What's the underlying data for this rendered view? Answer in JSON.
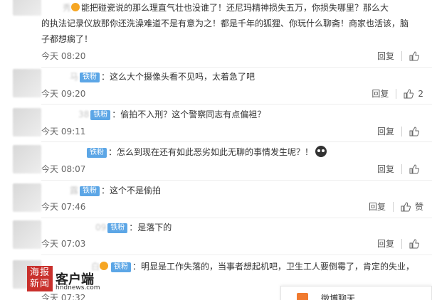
{
  "comments": [
    {
      "user": "秀",
      "badge": "",
      "lines": [
        "能把碰瓷说的那么理直气壮也没谁了！还尼玛精神损失五万，你损失哪里？那么大",
        "的执法记录仪放那你还洗澡难道不是有意为之！都是千年的狐狸、你玩什么聊斋！商家也活该，脑",
        "子都想瘸了！"
      ],
      "time": "今天 08:20",
      "reply": "回复",
      "likes": ""
    },
    {
      "user": "马",
      "badge": "铁粉",
      "lines": [
        "：这么大个摄像头看不见吗，太着急了吧"
      ],
      "time": "今天 09:20",
      "reply": "回复",
      "likes": "2"
    },
    {
      "user": "38",
      "badge": "铁粉",
      "lines": [
        "：偷拍不入刑？这个警察同志有点偏袒？"
      ],
      "time": "今天 09:11",
      "reply": "回复",
      "likes": ""
    },
    {
      "user": "",
      "badge": "铁粉",
      "lines": [
        "：怎么到现在还有如此恶劣如此无聊的事情发生呢？！"
      ],
      "time": "今天 08:07",
      "reply": "回复",
      "likes": ""
    },
    {
      "user": "露",
      "badge": "铁粉",
      "lines": [
        "：这个不是偷拍"
      ],
      "time": "今天 07:46",
      "reply": "回复",
      "likes": "赞"
    },
    {
      "user": "09",
      "badge": "铁粉",
      "lines": [
        "：是落下的"
      ],
      "time": "今天 07:03",
      "reply": "回复",
      "likes": ""
    },
    {
      "user": "白",
      "badge": "铁粉",
      "lines": [
        "：明显是工作失落的，当事者想起机吧，卫生工人要倒霉了，肯定的失业，"
      ],
      "time": "今天 07:32",
      "reply": "",
      "likes": ""
    }
  ],
  "watermark": {
    "logo_line1": "海报",
    "logo_line2": "新闻",
    "brand": "客户端",
    "sub": "hndnews.com"
  },
  "popup": {
    "text": "微博聊天"
  },
  "icons": {
    "like": "thumbs-up-icon",
    "emoji": "emoji-icon",
    "vip": "vip-icon",
    "message": "message-icon"
  },
  "colors": {
    "badge": "#5ca6e6",
    "logo": "#c9302c",
    "popup_icon": "#f07a2f"
  }
}
